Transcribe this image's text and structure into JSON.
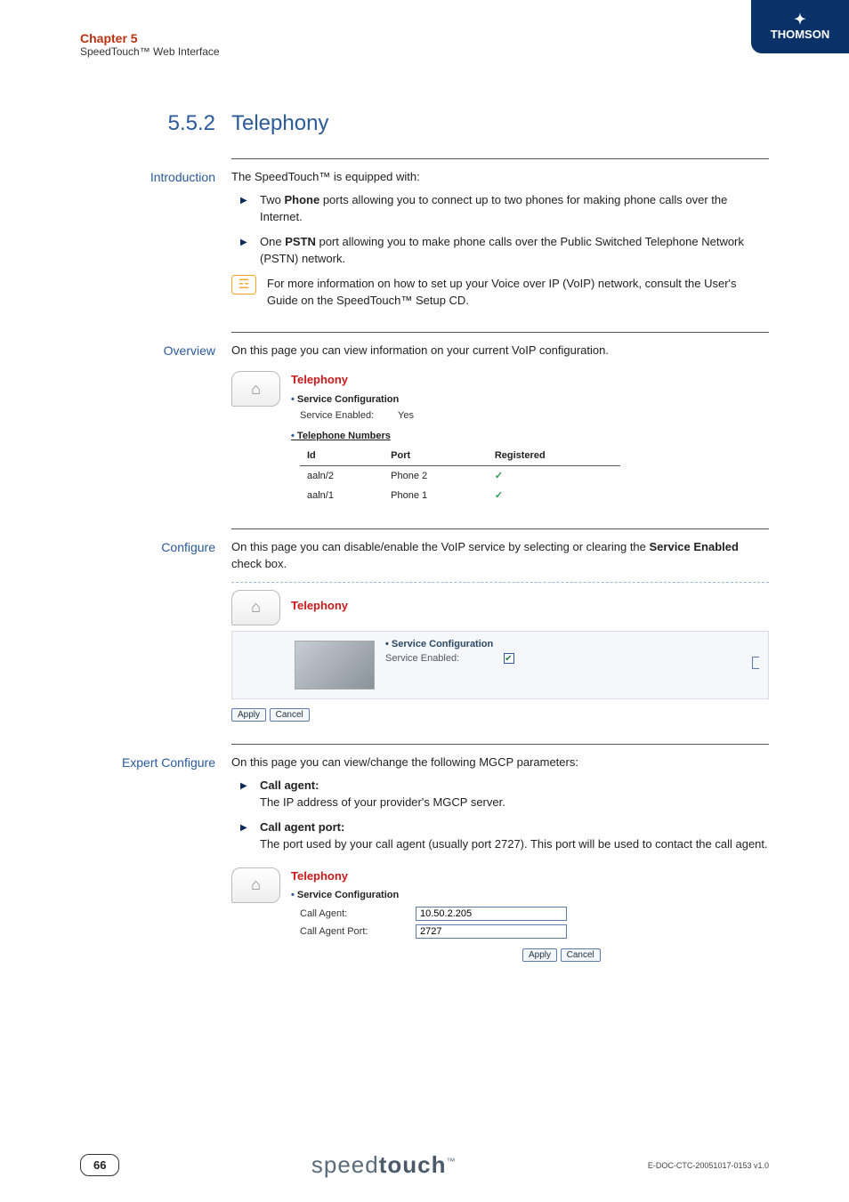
{
  "header": {
    "chapter": "Chapter 5",
    "subtitle": "SpeedTouch™ Web Interface",
    "brand": "THOMSON"
  },
  "section": {
    "number": "5.5.2",
    "title": "Telephony"
  },
  "intro": {
    "label": "Introduction",
    "lead": "The SpeedTouch™ is equipped with:",
    "bullets": [
      {
        "pre": "Two ",
        "bold": "Phone",
        "post": " ports allowing you to connect up to two phones for making phone calls over the Internet."
      },
      {
        "pre": "One ",
        "bold": "PSTN",
        "post": " port allowing you to make phone calls over the Public Switched Telephone Network (PSTN) network."
      }
    ],
    "info": "For more information on how to set up your Voice over IP (VoIP) network, consult the User's Guide on the SpeedTouch™ Setup CD."
  },
  "overview": {
    "label": "Overview",
    "text": "On this page you can view information on your current VoIP configuration.",
    "panel_title": "Telephony",
    "svc_conf_label": "Service Configuration",
    "service_enabled_label": "Service Enabled:",
    "service_enabled_value": "Yes",
    "tel_numbers_label": "Telephone Numbers",
    "cols": {
      "id": "Id",
      "port": "Port",
      "registered": "Registered"
    },
    "rows": [
      {
        "id": "aaln/2",
        "port": "Phone 2",
        "registered": "✓"
      },
      {
        "id": "aaln/1",
        "port": "Phone 1",
        "registered": "✓"
      }
    ]
  },
  "configure": {
    "label": "Configure",
    "text_pre": "On this page you can disable/enable the VoIP service by selecting or clearing the ",
    "text_bold": "Service Enabled",
    "text_post": " check box.",
    "panel_title": "Telephony",
    "svc_conf_label": "Service Configuration",
    "service_enabled_label": "Service Enabled:",
    "apply": "Apply",
    "cancel": "Cancel"
  },
  "expert": {
    "label": "Expert Configure",
    "text": "On this page you can view/change the following MGCP parameters:",
    "items": [
      {
        "title": "Call agent:",
        "desc": "The IP address of your provider's MGCP server."
      },
      {
        "title": "Call agent port:",
        "desc": "The port used by your call agent (usually port 2727). This port will be used to contact the call agent."
      }
    ],
    "panel_title": "Telephony",
    "svc_conf_label": "Service Configuration",
    "call_agent_label": "Call Agent:",
    "call_agent_value": "10.50.2.205",
    "call_agent_port_label": "Call Agent Port:",
    "call_agent_port_value": "2727",
    "apply": "Apply",
    "cancel": "Cancel"
  },
  "footer": {
    "page": "66",
    "brand_pre": "speed",
    "brand_bold": "touch",
    "tm": "™",
    "docid": "E-DOC-CTC-20051017-0153 v1.0"
  }
}
